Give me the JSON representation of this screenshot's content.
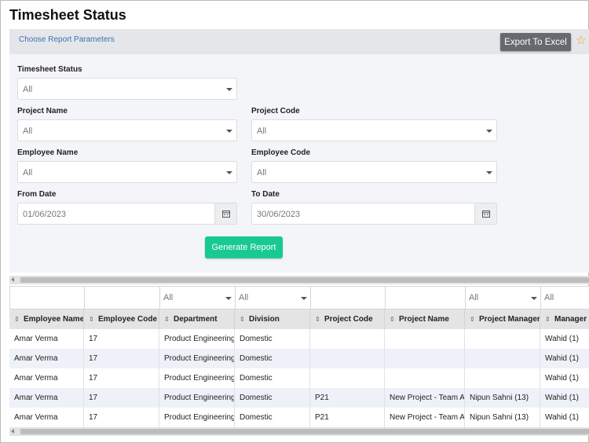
{
  "page": {
    "title": "Timesheet Status"
  },
  "params": {
    "link": "Choose Report Parameters",
    "export_label": "Export To Excel"
  },
  "form": {
    "timesheet_status": {
      "label": "Timesheet Status",
      "value": "All"
    },
    "project_name": {
      "label": "Project Name",
      "value": "All"
    },
    "project_code": {
      "label": "Project Code",
      "value": "All"
    },
    "employee_name": {
      "label": "Employee Name",
      "value": "All"
    },
    "employee_code": {
      "label": "Employee Code",
      "value": "All"
    },
    "from_date": {
      "label": "From Date",
      "value": "01/06/2023"
    },
    "to_date": {
      "label": "To Date",
      "value": "30/06/2023"
    },
    "generate_label": "Generate Report"
  },
  "table": {
    "filters": [
      "",
      "",
      "All",
      "All",
      "",
      "",
      "All",
      "All"
    ],
    "columns": [
      "Employee Name",
      "Employee Code",
      "Department",
      "Division",
      "Project Code",
      "Project Name",
      "Project Manager",
      "Manager Name"
    ],
    "rows": [
      [
        "Amar Verma",
        "17",
        "Product Engineering",
        "Domestic",
        "",
        "",
        "",
        "Wahid (1)"
      ],
      [
        "Amar Verma",
        "17",
        "Product Engineering",
        "Domestic",
        "",
        "",
        "",
        "Wahid (1)"
      ],
      [
        "Amar Verma",
        "17",
        "Product Engineering",
        "Domestic",
        "",
        "",
        "",
        "Wahid (1)"
      ],
      [
        "Amar Verma",
        "17",
        "Product Engineering",
        "Domestic",
        "P21",
        "New Project - Team A",
        "Nipun Sahni (13)",
        "Wahid (1)"
      ],
      [
        "Amar Verma",
        "17",
        "Product Engineering",
        "Domestic",
        "P21",
        "New Project - Team A",
        "Nipun Sahni (13)",
        "Wahid (1)"
      ]
    ]
  },
  "colors": {
    "accent_green": "#19c992",
    "excel_button": "#666a6e",
    "star": "#e8a21a",
    "link": "#3b72b0"
  },
  "icons": {
    "favorite": "star-icon",
    "calendar": "calendar-icon",
    "dropdown": "chevron-down-icon",
    "sort": "sort-icon"
  }
}
